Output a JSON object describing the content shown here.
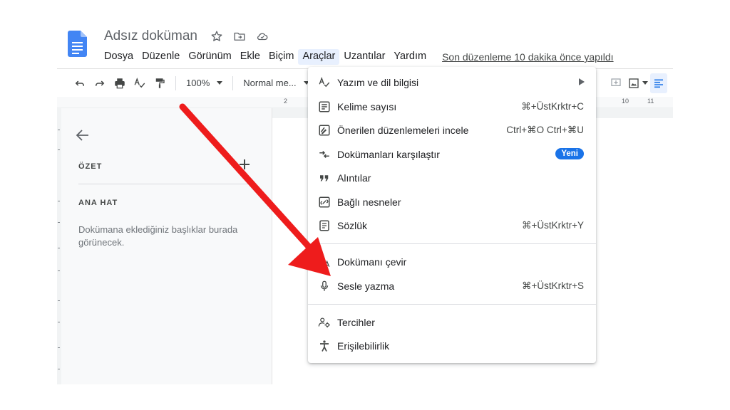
{
  "window": {
    "title": "Adsız doküman",
    "last_edit": "Son düzenleme 10 dakika önce yapıldı"
  },
  "menubar": {
    "items": [
      "Dosya",
      "Düzenle",
      "Görünüm",
      "Ekle",
      "Biçim",
      "Araçlar",
      "Uzantılar",
      "Yardım"
    ],
    "active": "Araçlar"
  },
  "toolbar": {
    "zoom": "100%",
    "style": "Normal me..."
  },
  "ruler": {
    "labels": [
      "2",
      "10",
      "11"
    ]
  },
  "sidebar": {
    "summary_heading": "ÖZET",
    "outline_heading": "ANA HAT",
    "outline_hint": "Dokümana eklediğiniz başlıklar burada görünecek."
  },
  "tools_menu": {
    "items": [
      {
        "label": "Yazım ve dil bilgisi",
        "icon": "spellcheck-icon",
        "submenu": true
      },
      {
        "label": "Kelime sayısı",
        "icon": "word-count-icon",
        "shortcut": "⌘+ÜstKrktr+C"
      },
      {
        "label": "Önerilen düzenlemeleri incele",
        "icon": "review-edits-icon",
        "shortcut": "Ctrl+⌘O Ctrl+⌘U"
      },
      {
        "label": "Dokümanları karşılaştır",
        "icon": "compare-icon",
        "badge": "Yeni"
      },
      {
        "label": "Alıntılar",
        "icon": "quote-icon"
      },
      {
        "label": "Bağlı nesneler",
        "icon": "linked-objects-icon"
      },
      {
        "label": "Sözlük",
        "icon": "dictionary-icon",
        "shortcut": "⌘+ÜstKrktr+Y"
      },
      {
        "label": "Dokümanı çevir",
        "icon": "translate-icon"
      },
      {
        "label": "Sesle yazma",
        "icon": "microphone-icon",
        "shortcut": "⌘+ÜstKrktr+S"
      },
      {
        "label": "Tercihler",
        "icon": "preferences-icon"
      },
      {
        "label": "Erişilebilirlik",
        "icon": "accessibility-icon"
      }
    ]
  },
  "colors": {
    "docs_blue": "#4285f4",
    "badge_blue": "#1a73e8",
    "arrow_red": "#ee1c1c",
    "active_menu_bg": "#e8f0fe"
  }
}
